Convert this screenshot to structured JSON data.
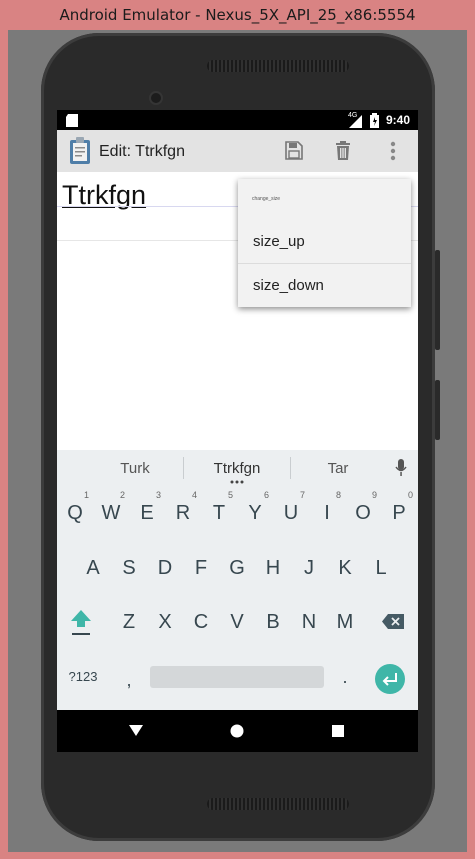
{
  "window": {
    "title": "Android Emulator - Nexus_5X_API_25_x86:5554"
  },
  "status_bar": {
    "network": "4G",
    "time": "9:40"
  },
  "app_bar": {
    "title": "Edit: Ttrkfgn",
    "icons": [
      "clipboard-icon",
      "save-icon",
      "delete-icon",
      "overflow-menu-icon"
    ]
  },
  "editor": {
    "title_text": "Ttrkfgn"
  },
  "popup_menu": {
    "header": "change_size",
    "items": [
      "size_up",
      "size_down"
    ]
  },
  "keyboard": {
    "suggestions": [
      "Turk",
      "Ttrkfgn",
      "Tar"
    ],
    "row1": [
      {
        "label": "Q",
        "num": "1"
      },
      {
        "label": "W",
        "num": "2"
      },
      {
        "label": "E",
        "num": "3"
      },
      {
        "label": "R",
        "num": "4"
      },
      {
        "label": "T",
        "num": "5"
      },
      {
        "label": "Y",
        "num": "6"
      },
      {
        "label": "U",
        "num": "7"
      },
      {
        "label": "I",
        "num": "8"
      },
      {
        "label": "O",
        "num": "9"
      },
      {
        "label": "P",
        "num": "0"
      }
    ],
    "row2": [
      "A",
      "S",
      "D",
      "F",
      "G",
      "H",
      "J",
      "K",
      "L"
    ],
    "row3": [
      "Z",
      "X",
      "C",
      "V",
      "B",
      "N",
      "M"
    ],
    "symbols_label": "?123",
    "comma_label": ",",
    "period_label": ".",
    "accent_color": "#3fb6a8"
  }
}
